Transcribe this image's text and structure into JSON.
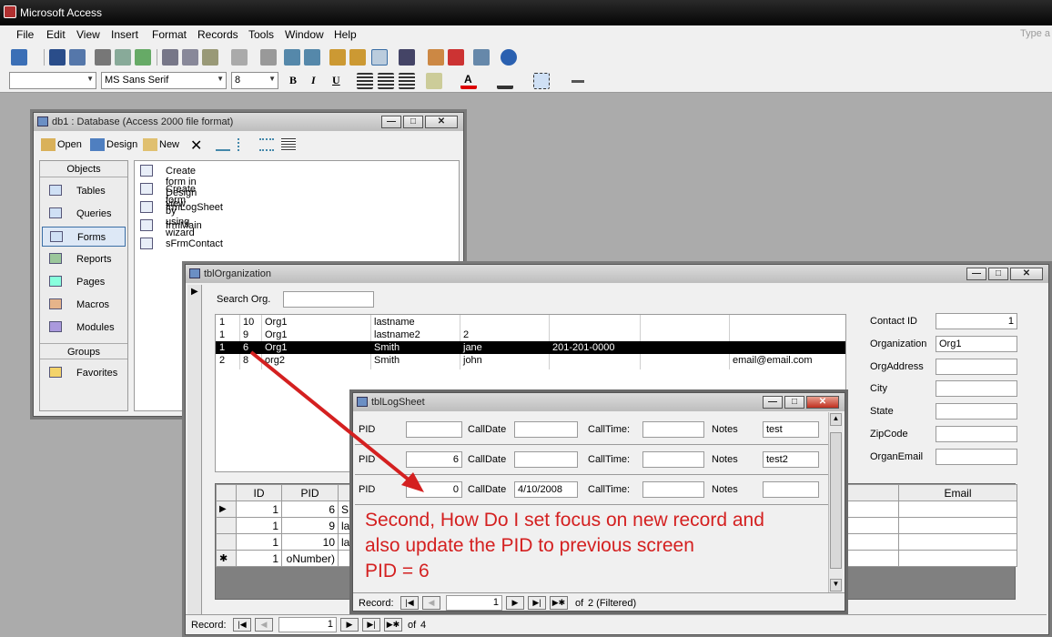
{
  "app": {
    "title": "Microsoft Access",
    "type_question": "Type a"
  },
  "menu": [
    "File",
    "Edit",
    "View",
    "Insert",
    "Format",
    "Records",
    "Tools",
    "Window",
    "Help"
  ],
  "format_bar": {
    "object_combo": "",
    "font": "MS Sans Serif",
    "size": "8",
    "bold": "B",
    "italic": "I",
    "underline": "U"
  },
  "db_window": {
    "title": "db1 : Database (Access 2000 file format)",
    "toolbar": {
      "open": "Open",
      "design": "Design",
      "new": "New"
    },
    "objects_header": "Objects",
    "objects": [
      "Tables",
      "Queries",
      "Forms",
      "Reports",
      "Pages",
      "Macros",
      "Modules"
    ],
    "groups_header": "Groups",
    "favorites": "Favorites",
    "items": [
      "Create form in Design view",
      "Create form by using wizard",
      "frmLogSheet",
      "frmMain",
      "sFrmContact"
    ]
  },
  "org_form": {
    "title": "tblOrganization",
    "search_label": "Search Org.",
    "search_value": "",
    "list_rows": [
      [
        "1",
        "10",
        "Org1",
        "lastname",
        "",
        "",
        "",
        ""
      ],
      [
        "1",
        "9",
        "Org1",
        "lastname2",
        "2",
        "",
        "",
        ""
      ],
      [
        "1",
        "6",
        "Org1",
        "Smith",
        "jane",
        "201-201-0000",
        "",
        ""
      ],
      [
        "2",
        "8",
        "org2",
        "Smith",
        "john",
        "",
        "",
        "email@email.com"
      ]
    ],
    "detail_labels": [
      "Contact ID",
      "Organization",
      "OrgAddress",
      "City",
      "State",
      "ZipCode",
      "OrganEmail"
    ],
    "detail_values": [
      "1",
      "Org1",
      "",
      "",
      "",
      "",
      ""
    ],
    "grid_headers": [
      "ID",
      "PID",
      "Email"
    ],
    "grid_rows": [
      {
        "sel": "▶",
        "id": "1",
        "pid": "6",
        "extra": "S"
      },
      {
        "sel": "",
        "id": "1",
        "pid": "9",
        "extra": "la"
      },
      {
        "sel": "",
        "id": "1",
        "pid": "10",
        "extra": "la"
      },
      {
        "sel": "✱",
        "id": "1",
        "pid": "oNumber)",
        "extra": ""
      }
    ],
    "nav": {
      "label": "Record:",
      "current": "1",
      "of": "of",
      "total": "4"
    }
  },
  "log_form": {
    "title": "tblLogSheet",
    "labels": {
      "pid": "PID",
      "calldate": "CallDate",
      "calltime": "CallTime:",
      "notes": "Notes"
    },
    "records": [
      {
        "pid": "",
        "calldate": "",
        "calltime": "",
        "notes": "test"
      },
      {
        "pid": "6",
        "calldate": "",
        "calltime": "",
        "notes": "test2"
      },
      {
        "pid": "0",
        "calldate": "4/10/2008",
        "calltime": "",
        "notes": ""
      }
    ],
    "nav": {
      "label": "Record:",
      "current": "1",
      "of": "of",
      "total": "2 (Filtered)"
    }
  },
  "annotation": {
    "lines": [
      "Second, How Do I set focus on new record and",
      "also update the PID to previous screen",
      "PID = 6"
    ],
    "color": "#d42020"
  }
}
